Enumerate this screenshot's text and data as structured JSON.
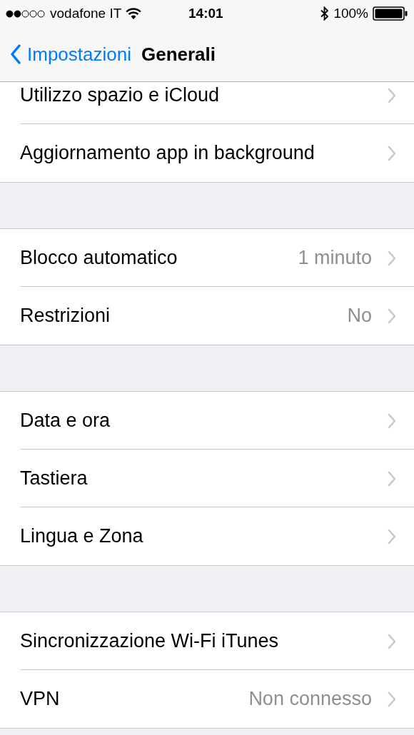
{
  "status_bar": {
    "carrier": "vodafone IT",
    "time": "14:01",
    "battery": "100%"
  },
  "nav_bar": {
    "back": "Impostazioni",
    "title": "Generali"
  },
  "groups": [
    {
      "rows": [
        {
          "label": "Utilizzo spazio e iCloud"
        },
        {
          "label": "Aggiornamento app in background"
        }
      ]
    },
    {
      "rows": [
        {
          "label": "Blocco automatico",
          "value": "1 minuto"
        },
        {
          "label": "Restrizioni",
          "value": "No"
        }
      ]
    },
    {
      "rows": [
        {
          "label": "Data e ora"
        },
        {
          "label": "Tastiera"
        },
        {
          "label": "Lingua e Zona"
        }
      ]
    },
    {
      "rows": [
        {
          "label": "Sincronizzazione Wi-Fi iTunes"
        },
        {
          "label": "VPN",
          "value": "Non connesso"
        }
      ]
    }
  ]
}
